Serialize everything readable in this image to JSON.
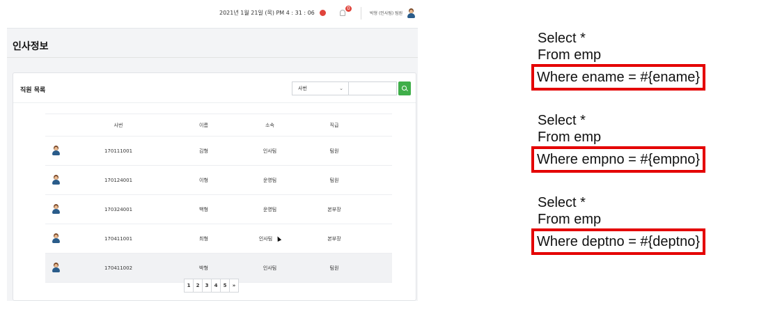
{
  "topbar": {
    "datetime": "2021년 1월 21일 (목) PM 4 : 31 : 06",
    "notification_count": "0",
    "user_label": "박형 (인사팀) 팀원"
  },
  "page": {
    "title": "인사정보"
  },
  "card": {
    "title": "직원 목록",
    "search_select_value": "사번",
    "search_input_value": ""
  },
  "table": {
    "headers": [
      "사번",
      "이름",
      "소속",
      "직급"
    ],
    "rows": [
      {
        "empno": "170111001",
        "name": "김형",
        "dept": "인사팀",
        "rank": "팀원"
      },
      {
        "empno": "170124001",
        "name": "이형",
        "dept": "운영팀",
        "rank": "팀원"
      },
      {
        "empno": "170324001",
        "name": "백형",
        "dept": "운영팀",
        "rank": "본부장"
      },
      {
        "empno": "170411001",
        "name": "최형",
        "dept": "인사팀",
        "rank": "본부장"
      },
      {
        "empno": "170411002",
        "name": "박형",
        "dept": "인사팀",
        "rank": "팀원"
      }
    ]
  },
  "pagination": [
    "1",
    "2",
    "3",
    "4",
    "5",
    "»"
  ],
  "sql_queries": [
    {
      "select": "Select *",
      "from": "From emp",
      "where": "Where ename = #{ename}"
    },
    {
      "select": "Select *",
      "from": "From emp",
      "where": "Where empno = #{empno}"
    },
    {
      "select": "Select *",
      "from": "From emp",
      "where": "Where deptno = #{deptno}"
    }
  ],
  "colors": {
    "highlight_box": "#e40000",
    "search_button": "#3fae49",
    "alert": "#e0443c"
  }
}
